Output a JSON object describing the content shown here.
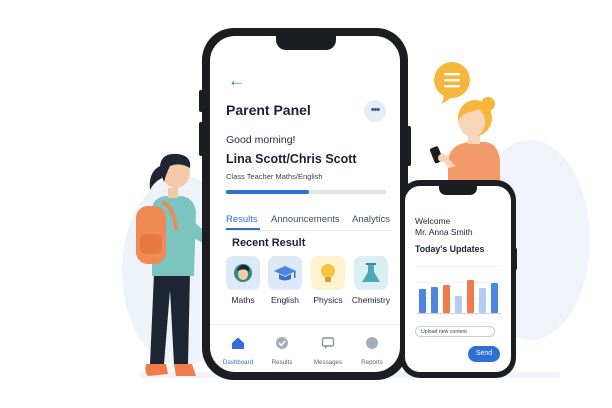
{
  "main_phone": {
    "header": {
      "title": "Parent Panel"
    },
    "greeting": "Good morning!",
    "parents": "Lina Scott/Chris Scott",
    "teacher_info": "Class Teacher Maths/English",
    "progress": 0.52,
    "tabs": [
      {
        "label": "Results",
        "active": true
      },
      {
        "label": "Announcements",
        "active": false
      },
      {
        "label": "Analytics",
        "active": false
      }
    ],
    "section_title": "Recent Result",
    "subjects": [
      {
        "label": "Maths",
        "icon": "student-avatar-icon",
        "tile_color": "#dde9f7"
      },
      {
        "label": "English",
        "icon": "graduation-cap-icon",
        "tile_color": "#dde9f7"
      },
      {
        "label": "Physics",
        "icon": "lightbulb-icon",
        "tile_color": "#fdf3cf"
      },
      {
        "label": "Chemistry",
        "icon": "flask-icon",
        "tile_color": "#d9eff2"
      }
    ],
    "bottom_nav": [
      {
        "label": "Dashboard",
        "icon": "home-icon",
        "active": true
      },
      {
        "label": "Results",
        "icon": "check-circle-icon",
        "active": false
      },
      {
        "label": "Messages",
        "icon": "message-icon",
        "active": false
      },
      {
        "label": "Reports",
        "icon": "reports-icon",
        "active": false
      }
    ]
  },
  "secondary_phone": {
    "welcome": "Welcome",
    "teacher_name": "Mr. Anna Smith",
    "updates_title": "Today's Updates",
    "chart_bars": [
      {
        "value": 0.5,
        "color": "#4d86e0"
      },
      {
        "value": 0.55,
        "color": "#4d86e0"
      },
      {
        "value": 0.58,
        "color": "#f07a4a"
      },
      {
        "value": 0.35,
        "color": "#b6cdf0"
      },
      {
        "value": 0.68,
        "color": "#f07a4a"
      },
      {
        "value": 0.52,
        "color": "#b6cdf0"
      },
      {
        "value": 0.62,
        "color": "#4d86e0"
      }
    ],
    "upload_label": "Upload new content",
    "send_label": "Send"
  },
  "colors": {
    "accent": "#2f6fd6",
    "orange": "#f07a4a",
    "phone_frame": "#1c1d21"
  },
  "decorations": {
    "speech_bubble_icon": "menu-lines-icon"
  }
}
